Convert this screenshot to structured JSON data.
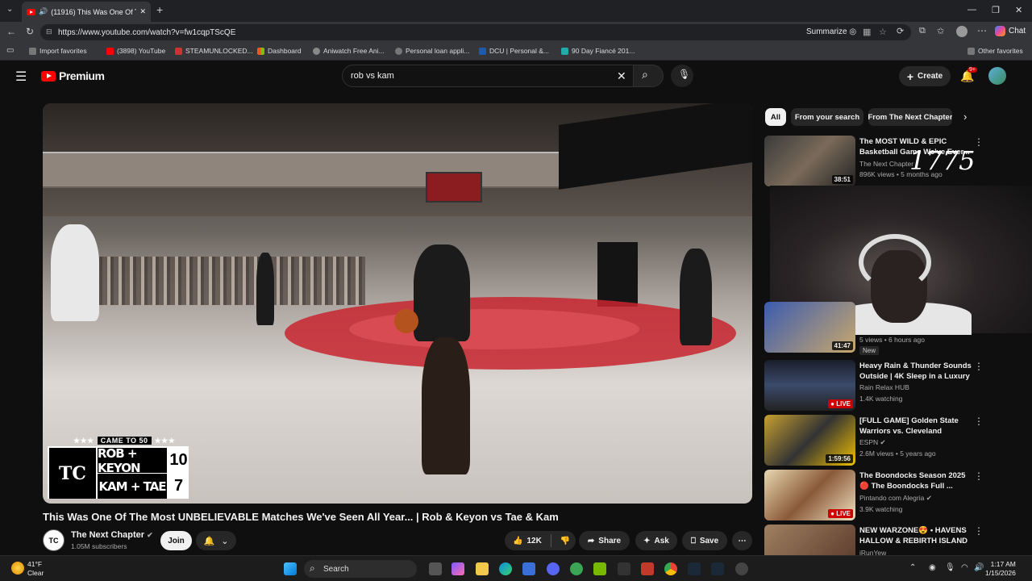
{
  "browser": {
    "tab_title": "(11916) This Was One Of The",
    "url": "https://www.youtube.com/watch?v=fw1cqpTScQE",
    "summarize_label": "Summarize",
    "chat_label": "Chat",
    "bookmarks": [
      {
        "label": "Import favorites"
      },
      {
        "label": "(3898) YouTube"
      },
      {
        "label": "STEAMUNLOCKED..."
      },
      {
        "label": "Dashboard"
      },
      {
        "label": "Aniwatch Free Ani..."
      },
      {
        "label": "Personal loan appli..."
      },
      {
        "label": "DCU | Personal &..."
      },
      {
        "label": "90 Day Fiancé 201..."
      }
    ],
    "other_favorites": "Other favorites"
  },
  "youtube": {
    "logo_text": "Premium",
    "search_value": "rob vs kam",
    "create_label": "Create",
    "notif_count": "9+"
  },
  "video": {
    "overlay": {
      "header": "CAME TO 50",
      "team1": "ROB + KEYON",
      "score1": "10",
      "team2": "KAM + TAE",
      "score2": "7"
    },
    "title": "This Was One Of The Most UNBELIEVABLE Matches We've Seen All Year... | Rob & Keyon vs Tae & Kam",
    "channel": "The Next Chapter",
    "subscribers": "1.05M subscribers",
    "join_label": "Join",
    "likes": "12K",
    "share_label": "Share",
    "ask_label": "Ask",
    "save_label": "Save"
  },
  "sidebar": {
    "chips": [
      "All",
      "From your search",
      "From The Next Chapter"
    ],
    "items": [
      {
        "title": "The MOST WILD & EPIC Basketball Game We've Ever...",
        "channel": "The Next Chapter",
        "meta": "896K views • 5 months ago",
        "duration": "38:51"
      },
      {
        "title": "",
        "channel": "",
        "meta": "5 views • 6 hours ago",
        "duration": "41:47",
        "badge": "New"
      },
      {
        "title": "Heavy Rain & Thunder Sounds Outside | 4K Sleep in a Luxury ...",
        "channel": "Rain Relax HUB",
        "meta": "1.4K watching",
        "duration": "LIVE"
      },
      {
        "title": "[FULL GAME] Golden State Warriors vs. Cleveland Cavalie...",
        "channel": "ESPN",
        "meta": "2.6M views • 5 years ago",
        "duration": "1:59:56"
      },
      {
        "title": "The Boondocks Season 2025 🔴 The Boondocks Full ...",
        "channel": "Pintando com Alegria",
        "meta": "3.9K watching",
        "duration": "LIVE"
      },
      {
        "title": "NEW WARZONE😍 • HAVENS HALLOW & REBIRTH ISLAND👑",
        "channel": "iRunYew",
        "meta": "",
        "duration": ""
      }
    ],
    "stream_overlay_count": "1775"
  },
  "taskbar": {
    "weather_temp": "41°F",
    "weather_desc": "Clear",
    "search_label": "Search",
    "time": "1:17 AM",
    "date": "1/15/2026"
  }
}
